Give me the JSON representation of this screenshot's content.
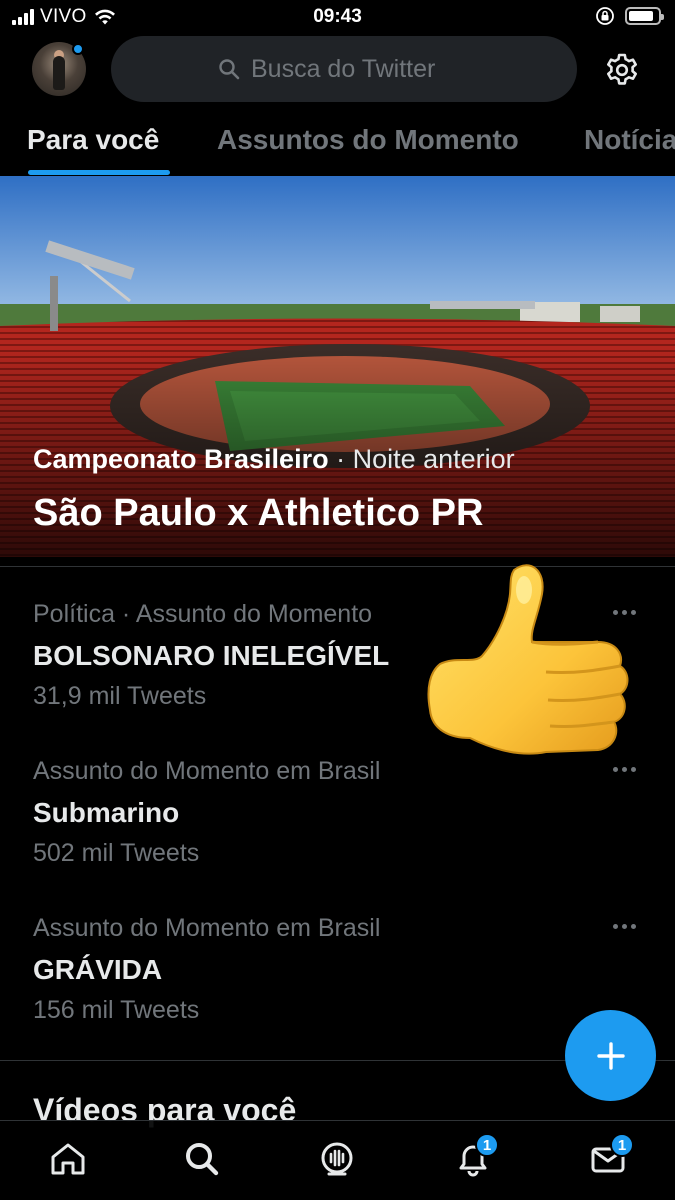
{
  "status_bar": {
    "carrier": "VIVO",
    "time": "09:43",
    "battery_level": 0.85
  },
  "header": {
    "search_placeholder": "Busca do Twitter",
    "avatar_notification": true
  },
  "tabs": [
    {
      "label": "Para você",
      "active": true
    },
    {
      "label": "Assuntos do Momento",
      "active": false
    },
    {
      "label": "Notícias",
      "active": false
    }
  ],
  "hero": {
    "category": "Campeonato Brasileiro",
    "separator": " · ",
    "time": "Noite anterior",
    "title": "São Paulo x Athletico PR"
  },
  "trends": [
    {
      "context": "Política · Assunto do Momento",
      "name": "BOLSONARO INELEGÍVEL",
      "count": "31,9 mil Tweets"
    },
    {
      "context": "Assunto do Momento em Brasil",
      "name": "Submarino",
      "count": "502 mil Tweets"
    },
    {
      "context": "Assunto do Momento em Brasil",
      "name": "GRÁVIDA",
      "count": "156 mil Tweets"
    }
  ],
  "section": {
    "title": "Vídeos para você"
  },
  "bottom_nav": {
    "items": [
      "home-icon",
      "search-icon",
      "spaces-icon",
      "bell-icon",
      "mail-icon"
    ],
    "notifications_badge": "1",
    "messages_badge": "1"
  },
  "colors": {
    "accent": "#1d9bf0",
    "background": "#000000",
    "muted": "#71767b"
  }
}
